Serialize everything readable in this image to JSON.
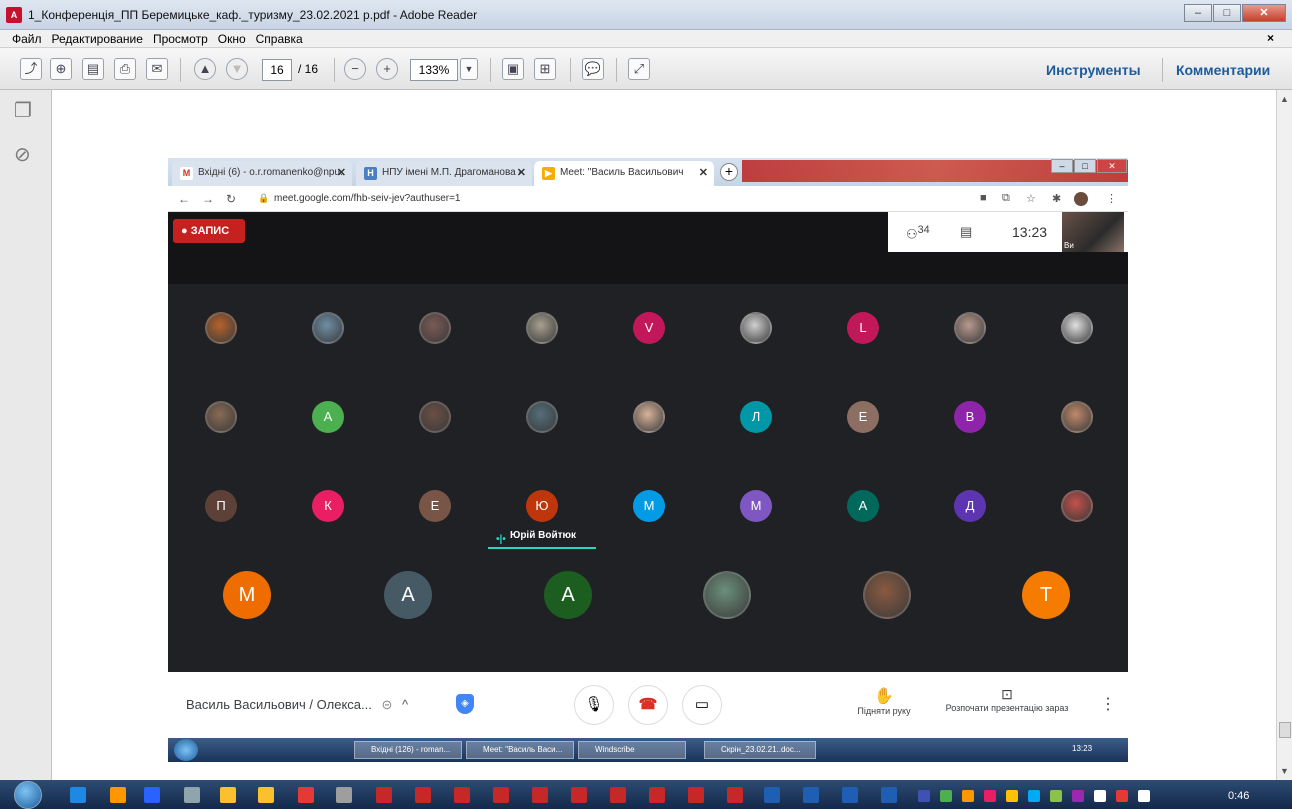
{
  "window": {
    "title": "1_Конференція_ПП Беремицьке_каф._туризму_23.02.2021 р.pdf - Adobe Reader",
    "controls": [
      "–",
      "□",
      "✕"
    ]
  },
  "menu": {
    "items": [
      "Файл",
      "Редактирование",
      "Просмотр",
      "Окно",
      "Справка"
    ],
    "close": "×"
  },
  "toolbar": {
    "page_current": "16",
    "page_total": "/ 16",
    "zoom": "133%",
    "tools_label": "Инструменты",
    "comments_label": "Комментарии"
  },
  "browser": {
    "tabs": [
      {
        "label": "Вхідні (6) - o.r.romanenko@npu.",
        "icon": "gmail-icon",
        "color": "#ffffff",
        "glyph": "M"
      },
      {
        "label": "НПУ імені М.П. Драгоманова -",
        "icon": "page-icon",
        "color": "#4a7fc1",
        "glyph": "Н"
      },
      {
        "label": "Meet: \"Василь Васильович",
        "icon": "meet-icon",
        "color": "#f9ab00",
        "glyph": "▶"
      }
    ],
    "tab_close": "✕",
    "new_tab": "+",
    "url": "meet.google.com/fhb-seiv-jev?authuser=1"
  },
  "meet": {
    "recording_label": "ЗАПИС",
    "participants_count": "34",
    "time": "13:23",
    "self_name": "Ви",
    "speaker_name": "Юрій Войтюк",
    "meeting_title": "Василь Васильович / Олекса...",
    "raise_hand_label": "Підняти руку",
    "present_label": "Розпочати презентацію зараз",
    "rows": [
      [
        {
          "type": "photo",
          "color": "#b5622b"
        },
        {
          "type": "photo",
          "color": "#6e8fa6"
        },
        {
          "type": "photo",
          "color": "#7b5a55"
        },
        {
          "type": "photo",
          "color": "#a8a090"
        },
        {
          "type": "letter",
          "letter": "V",
          "color": "#c2185b"
        },
        {
          "type": "photo",
          "color": "#cfcfcf"
        },
        {
          "type": "letter",
          "letter": "L",
          "color": "#c2185b"
        },
        {
          "type": "photo",
          "color": "#b89a8d"
        },
        {
          "type": "photo",
          "color": "#e0e0e0"
        }
      ],
      [
        {
          "type": "photo",
          "color": "#8a6b55"
        },
        {
          "type": "letter",
          "letter": "А",
          "color": "#4caf50"
        },
        {
          "type": "photo",
          "color": "#6b4f45"
        },
        {
          "type": "photo",
          "color": "#546e7a"
        },
        {
          "type": "photo",
          "color": "#d8b39a"
        },
        {
          "type": "letter",
          "letter": "Л",
          "color": "#0097a7"
        },
        {
          "type": "letter",
          "letter": "Е",
          "color": "#8d6e63"
        },
        {
          "type": "letter",
          "letter": "В",
          "color": "#8e24aa"
        },
        {
          "type": "photo",
          "color": "#c08a6a"
        }
      ],
      [
        {
          "type": "letter",
          "letter": "П",
          "color": "#5d4037"
        },
        {
          "type": "letter",
          "letter": "К",
          "color": "#e91e63"
        },
        {
          "type": "letter",
          "letter": "Е",
          "color": "#795548"
        },
        {
          "type": "letter",
          "letter": "Ю",
          "color": "#bf360c"
        },
        {
          "type": "letter",
          "letter": "М",
          "color": "#039be5"
        },
        {
          "type": "letter",
          "letter": "М",
          "color": "#7e57c2"
        },
        {
          "type": "letter",
          "letter": "А",
          "color": "#00695c"
        },
        {
          "type": "letter",
          "letter": "Д",
          "color": "#5e35b1"
        },
        {
          "type": "photo",
          "color": "#c4504a"
        }
      ],
      [
        {
          "type": "letter",
          "letter": "М",
          "color": "#ef6c00"
        },
        {
          "type": "letter",
          "letter": "А",
          "color": "#455a64"
        },
        {
          "type": "letter",
          "letter": "А",
          "color": "#1b5e20"
        },
        {
          "type": "photo",
          "color": "#6b8f7a"
        },
        {
          "type": "photo",
          "color": "#8a5a40"
        },
        {
          "type": "letter",
          "letter": "Т",
          "color": "#f57c00"
        }
      ]
    ]
  },
  "vm_taskbar": {
    "tasks": [
      "Вхідні (126) - roman...",
      "Meet: \"Василь Васи...",
      "Windscribe",
      "Скрін_23.02.21..doc..."
    ],
    "time": "13:23"
  },
  "taskbar": {
    "time": "0:46"
  },
  "colors": {
    "meet_bg": "#202124",
    "record_red": "#c5221f",
    "speaking_accent": "#26d7c0",
    "reader_link": "#1c5b9e"
  }
}
